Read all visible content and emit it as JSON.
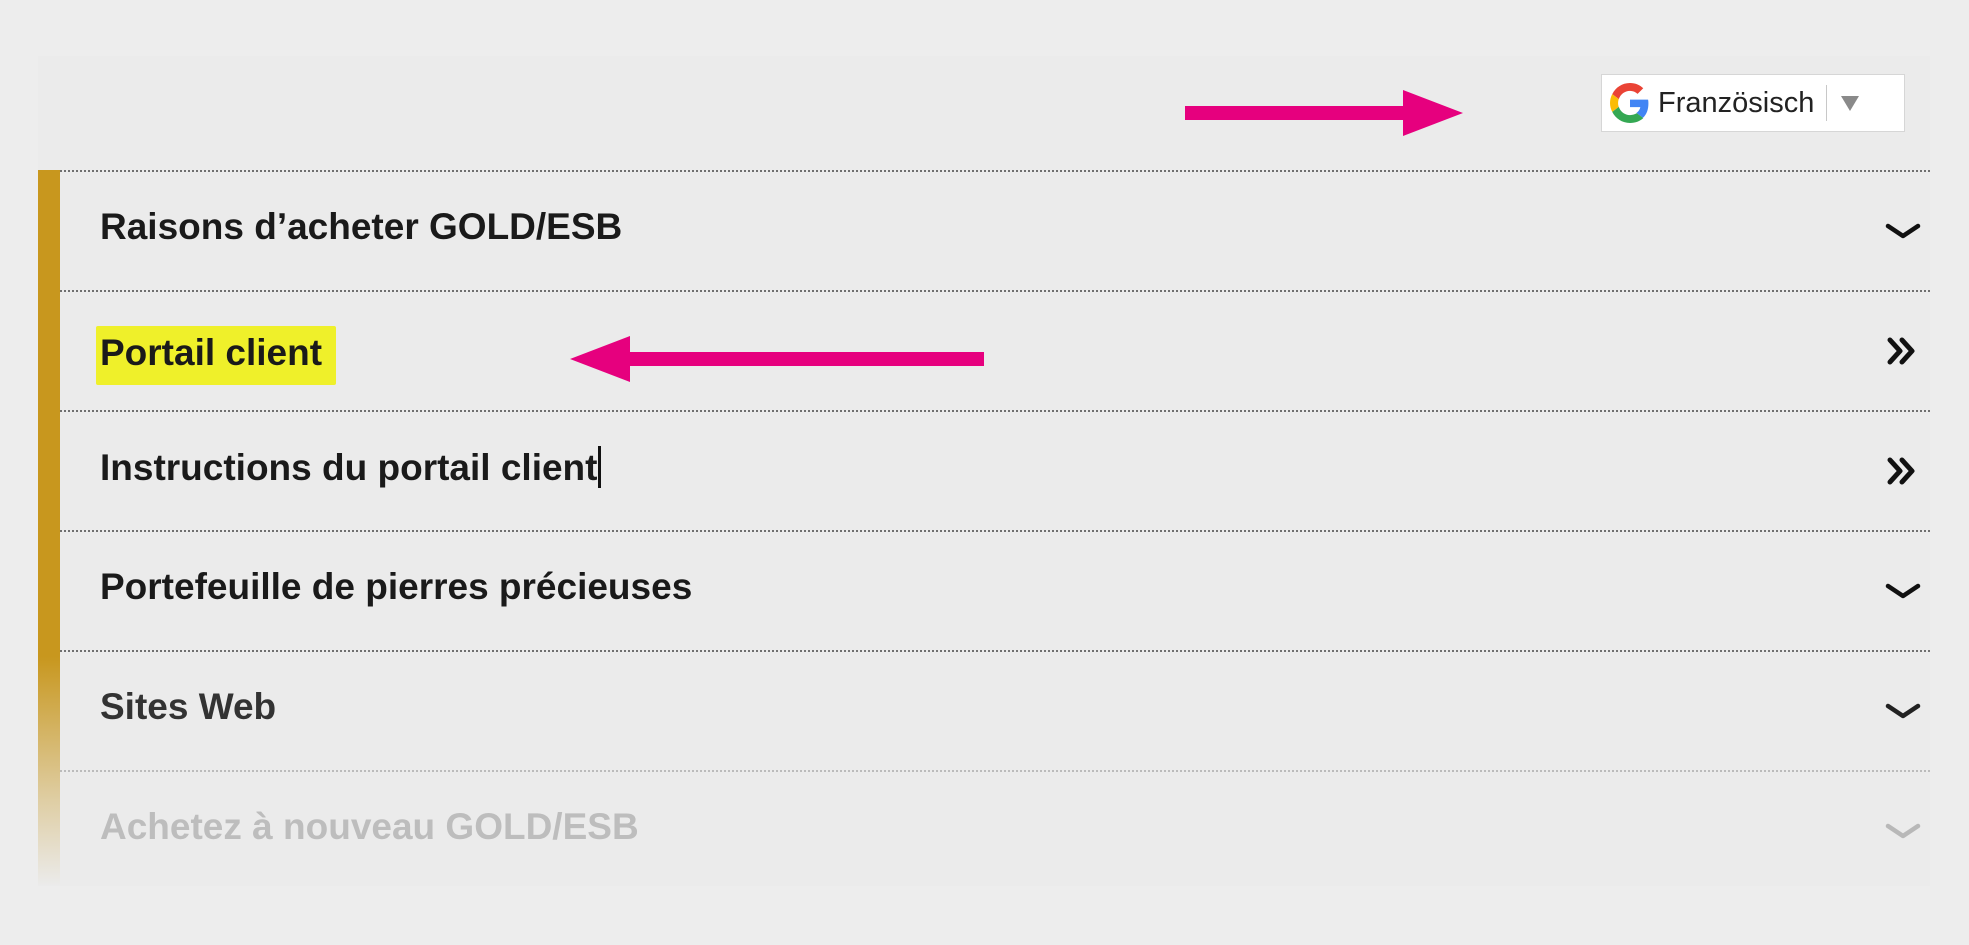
{
  "translate_widget": {
    "language": "Französisch",
    "icon": "google-g-icon",
    "dropdown_icon": "triangle-down-icon"
  },
  "menu": {
    "items": [
      {
        "label": "Raisons d’acheter GOLD/ESB",
        "icon": "chevron-down-icon"
      },
      {
        "label": "Portail client",
        "icon": "double-chevron-right-icon"
      },
      {
        "label": "Instructions du portail client",
        "icon": "double-chevron-right-icon"
      },
      {
        "label": "Portefeuille de pierres précieuses",
        "icon": "chevron-down-icon"
      },
      {
        "label": "Sites Web",
        "icon": "chevron-down-icon"
      },
      {
        "label": "Achetez à nouveau GOLD/ESB",
        "icon": "chevron-down-icon"
      }
    ]
  },
  "annotations": {
    "arrow_color": "#e6007e",
    "highlight_color": "#eff02a",
    "accent_color": "#c8971e"
  }
}
